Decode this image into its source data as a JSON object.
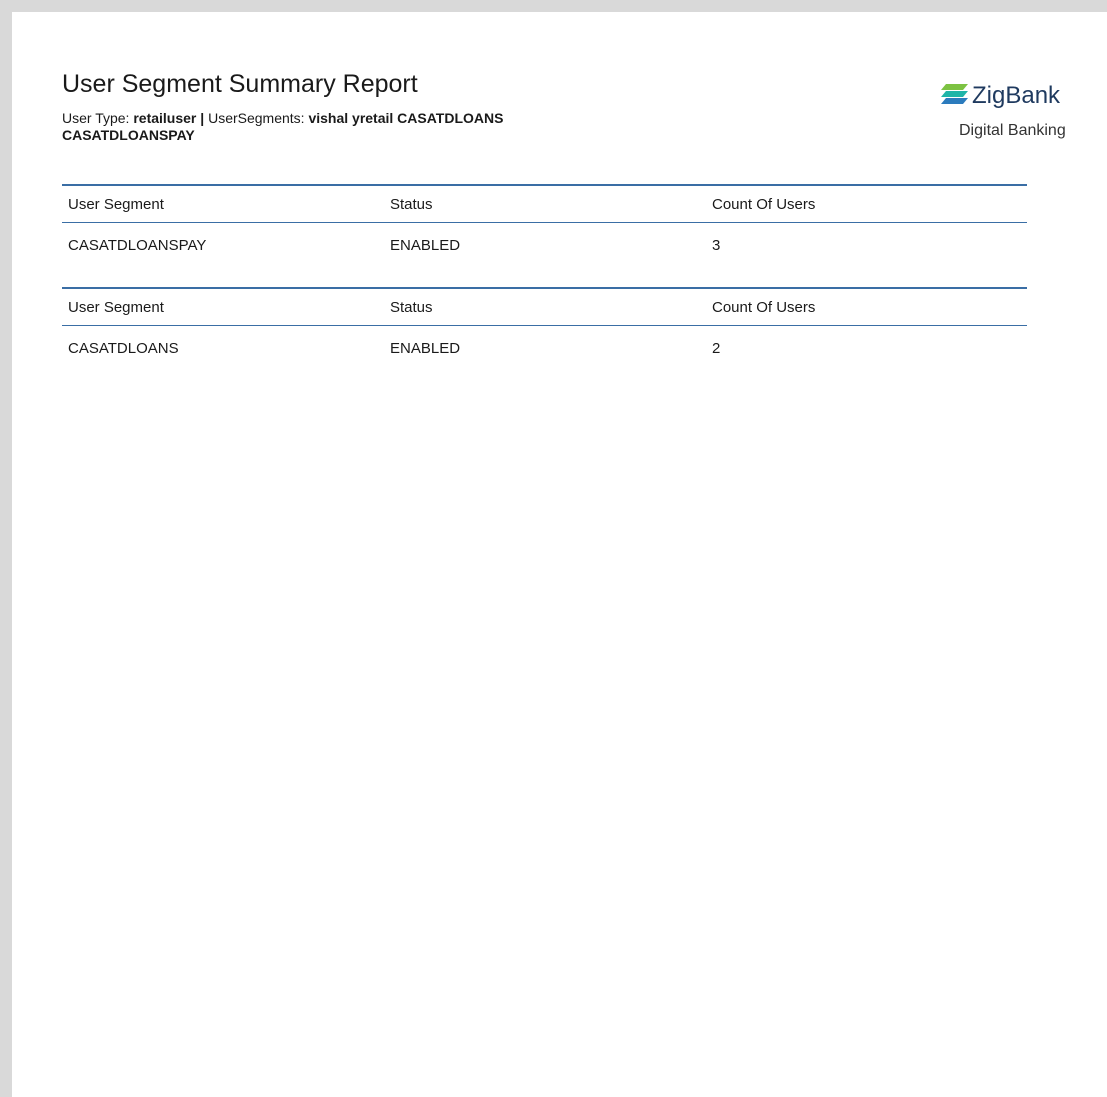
{
  "report": {
    "title": "User Segment Summary Report",
    "user_type_label": "User Type: ",
    "user_type_value": "retailuser",
    "separator": " | ",
    "segments_label": "UserSegments: ",
    "segments_value": "vishal yretail CASATDLOANS CASATDLOANSPAY"
  },
  "brand": {
    "name": "ZigBank",
    "tagline": "Digital Banking",
    "logo_icon": "zigbank-logo-icon",
    "colors": {
      "logo_green": "#7cc242",
      "logo_blue": "#2b7bbd",
      "logo_teal": "#1fb5a8",
      "name_navy": "#1f3a5f"
    }
  },
  "tables": [
    {
      "headers": [
        "User Segment",
        "Status",
        "Count Of Users"
      ],
      "rows": [
        {
          "segment": "CASATDLOANSPAY",
          "status": "ENABLED",
          "count": "3"
        }
      ]
    },
    {
      "headers": [
        "User Segment",
        "Status",
        "Count Of Users"
      ],
      "rows": [
        {
          "segment": "CASATDLOANS",
          "status": "ENABLED",
          "count": "2"
        }
      ]
    }
  ],
  "colors": {
    "rule_blue": "#3a6ea5",
    "page_background": "#ffffff",
    "surround": "#d9d9d9"
  }
}
